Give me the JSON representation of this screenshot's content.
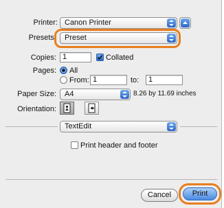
{
  "printer": {
    "label": "Printer:",
    "value": "Canon Printer"
  },
  "presets": {
    "label": "Presets:",
    "value": "Preset"
  },
  "copies": {
    "label": "Copies:",
    "value": "1",
    "collated_label": "Collated",
    "collated_checked": true
  },
  "pages": {
    "label": "Pages:",
    "all_label": "All",
    "from_label": "From:",
    "from_value": "1",
    "to_label": "to:",
    "to_value": "1"
  },
  "paper_size": {
    "label": "Paper Size:",
    "value": "A4",
    "dimensions": "8.26 by 11.69 inches"
  },
  "orientation": {
    "label": "Orientation:"
  },
  "section_popup": {
    "value": "TextEdit"
  },
  "header_footer": {
    "label": "Print header and footer",
    "checked": false
  },
  "buttons": {
    "cancel": "Cancel",
    "print": "Print"
  },
  "colors": {
    "highlight": "#e87e1e",
    "accent": "#2b67cb"
  }
}
